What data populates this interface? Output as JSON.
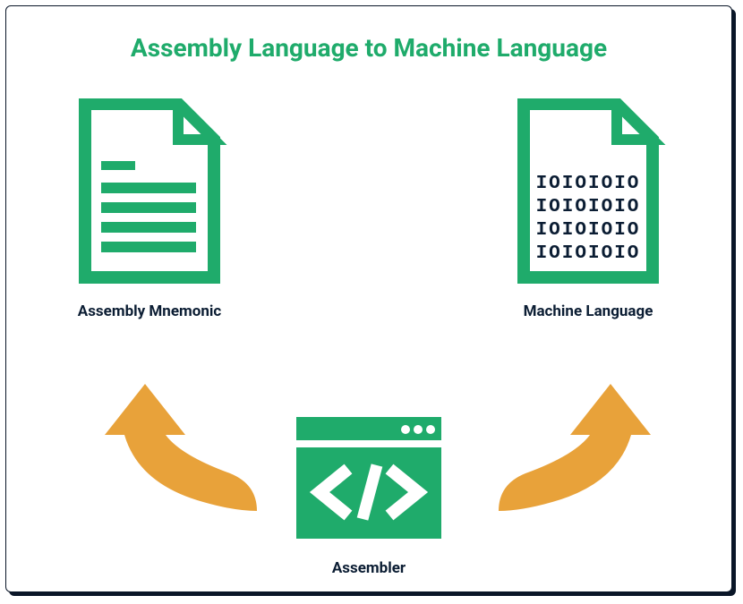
{
  "title": "Assembly Language to Machine Language",
  "left": {
    "label": "Assembly Mnemonic"
  },
  "right": {
    "label": "Machine Language",
    "binary": [
      "IOIOIOIO",
      "IOIOIOIO",
      "IOIOIOIO",
      "IOIOIOIO"
    ]
  },
  "center": {
    "label": "Assembler"
  },
  "colors": {
    "accent": "#1fab6b",
    "arrow": "#e8a23a",
    "text": "#0b1d33"
  }
}
